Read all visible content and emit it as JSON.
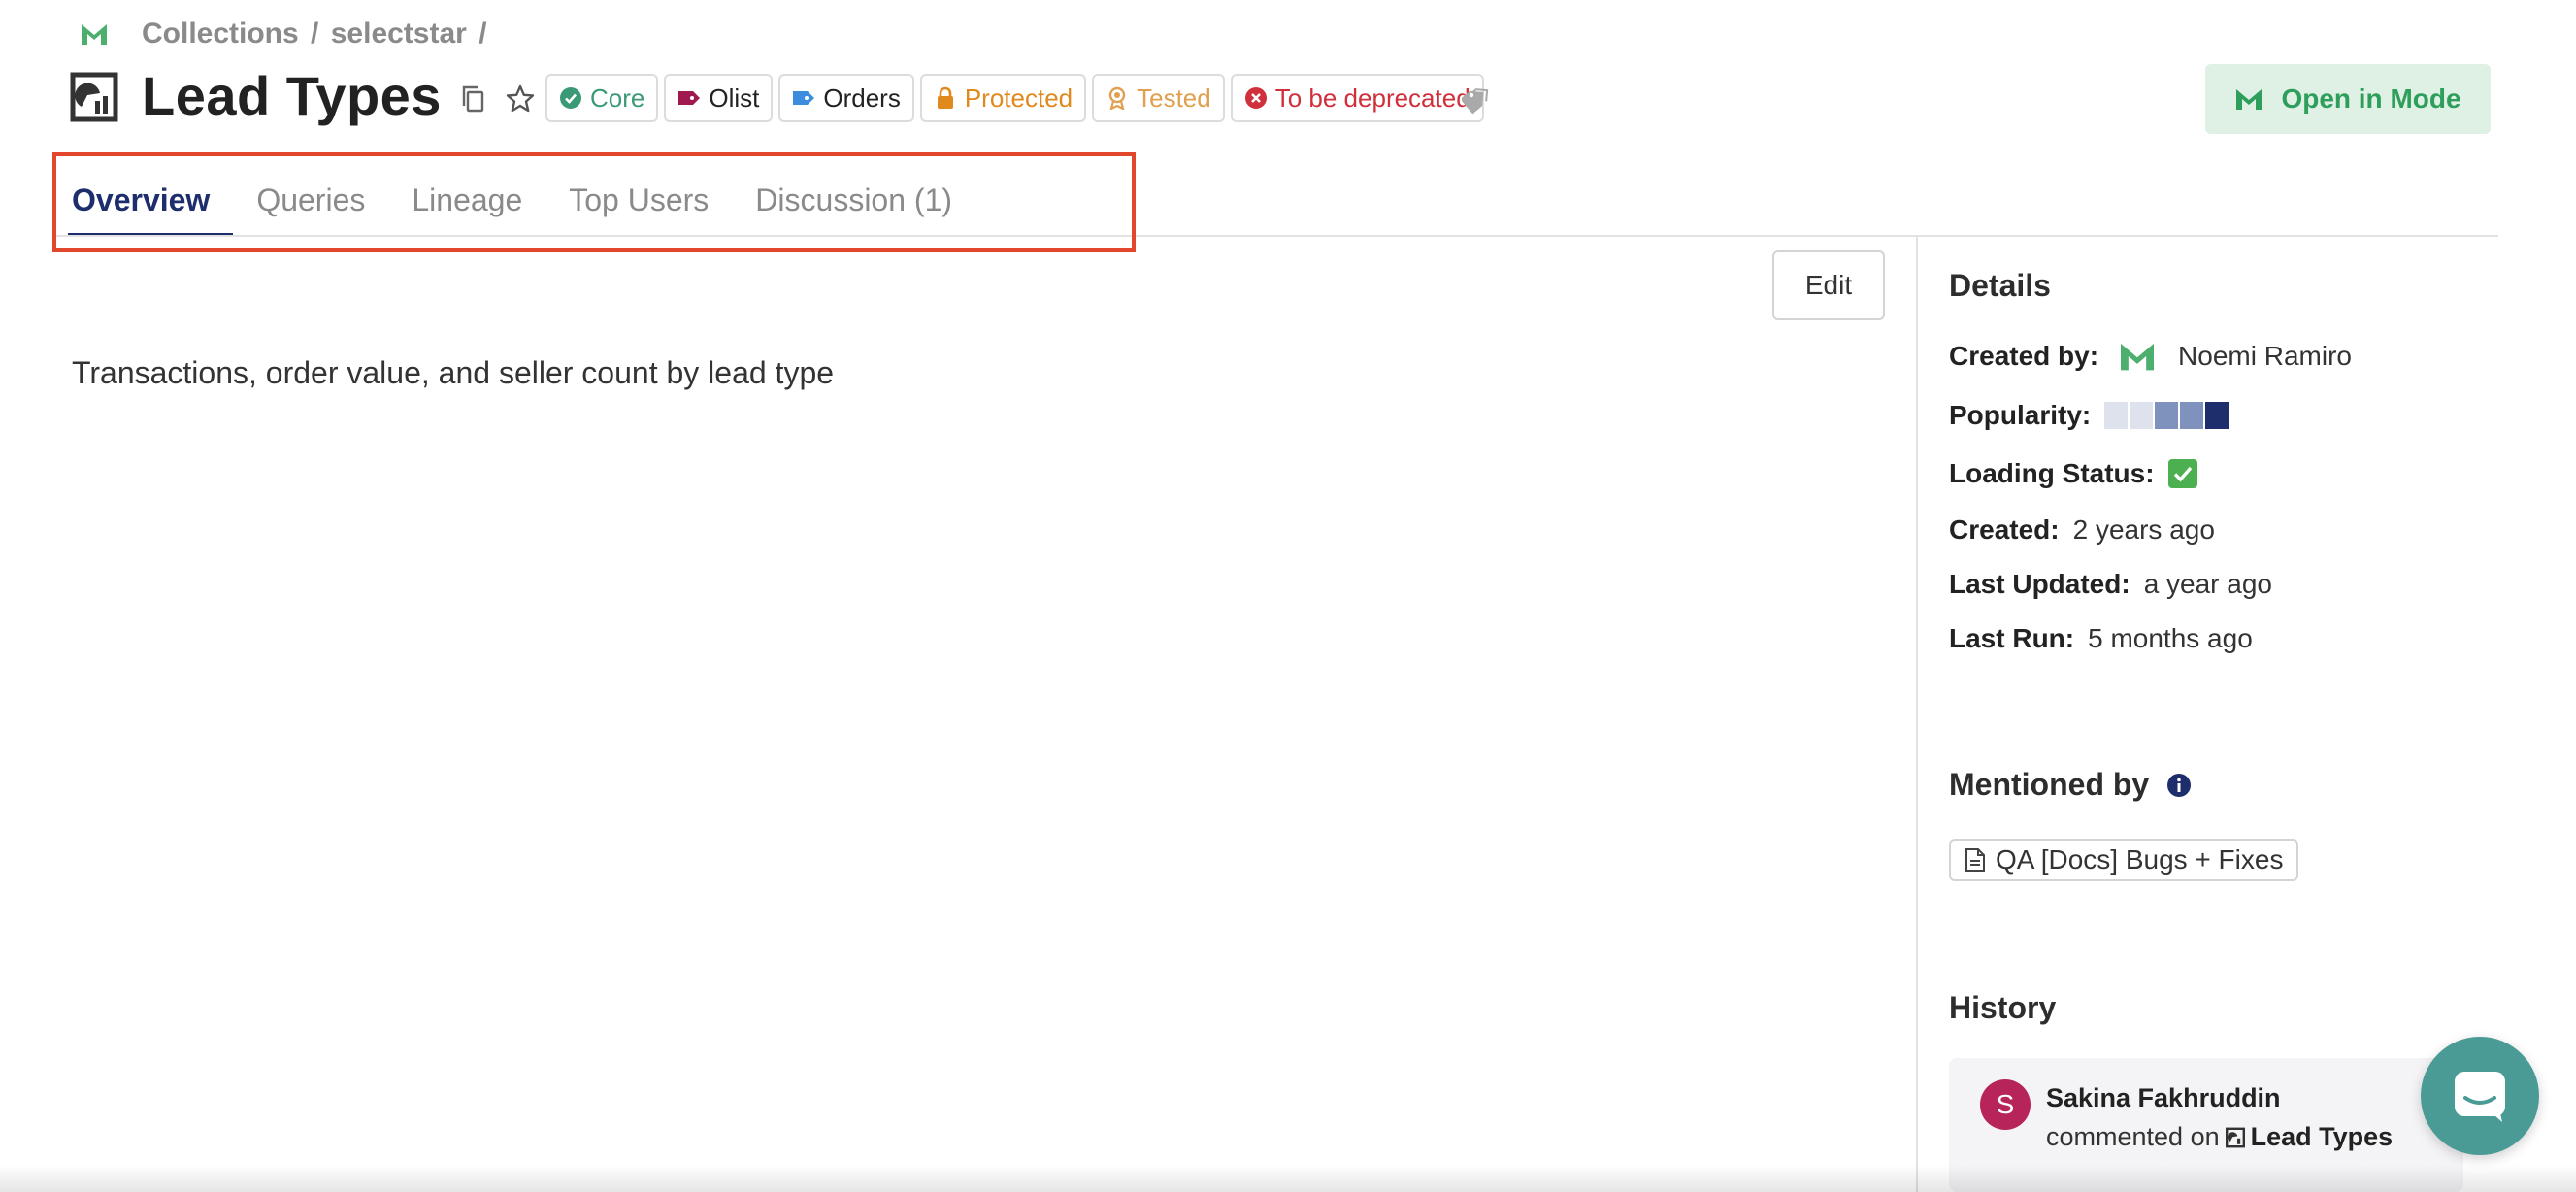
{
  "breadcrumb": {
    "items": [
      "Collections",
      "/",
      "selectstar",
      "/"
    ]
  },
  "header": {
    "title": "Lead Types",
    "tags": [
      {
        "label": "Core",
        "color": "#3b9a76",
        "icon": "check-circle-icon"
      },
      {
        "label": "Olist",
        "color": "#222222",
        "icon": "tag-icon",
        "icon_color": "#a0194f"
      },
      {
        "label": "Orders",
        "color": "#222222",
        "icon": "tag-icon",
        "icon_color": "#3c8de0"
      },
      {
        "label": "Protected",
        "color": "#e08a1e",
        "icon": "lock-icon"
      },
      {
        "label": "Tested",
        "color": "#e0a050",
        "icon": "award-icon"
      },
      {
        "label": "To be deprecated",
        "color": "#d0303b",
        "icon": "x-circle-icon"
      }
    ],
    "open_button": "Open in Mode"
  },
  "tabs": [
    {
      "label": "Overview",
      "active": true
    },
    {
      "label": "Queries",
      "active": false
    },
    {
      "label": "Lineage",
      "active": false
    },
    {
      "label": "Top Users",
      "active": false
    },
    {
      "label": "Discussion (1)",
      "active": false
    }
  ],
  "main": {
    "edit_label": "Edit",
    "description": "Transactions, order value, and seller count by lead type"
  },
  "details": {
    "heading": "Details",
    "created_by_label": "Created by:",
    "created_by": "Noemi Ramiro",
    "popularity_label": "Popularity:",
    "popularity_level": 3,
    "popularity_max": 5,
    "loading_status_label": "Loading Status:",
    "loading_status": "✅",
    "created_label": "Created:",
    "created": "2 years ago",
    "last_updated_label": "Last Updated:",
    "last_updated": "a year ago",
    "last_run_label": "Last Run:",
    "last_run": "5 months ago"
  },
  "mentioned": {
    "heading": "Mentioned by",
    "items": [
      "QA [Docs] Bugs + Fixes"
    ]
  },
  "history": {
    "heading": "History",
    "entry": {
      "avatar_initial": "S",
      "user": "Sakina Fakhruddin",
      "action": "commented on",
      "target": "Lead Types"
    }
  },
  "colors": {
    "accent": "#1e2d6b",
    "mode_green": "#2e9e5b",
    "highlight": "#e2472e",
    "chat": "#4a9a95"
  }
}
